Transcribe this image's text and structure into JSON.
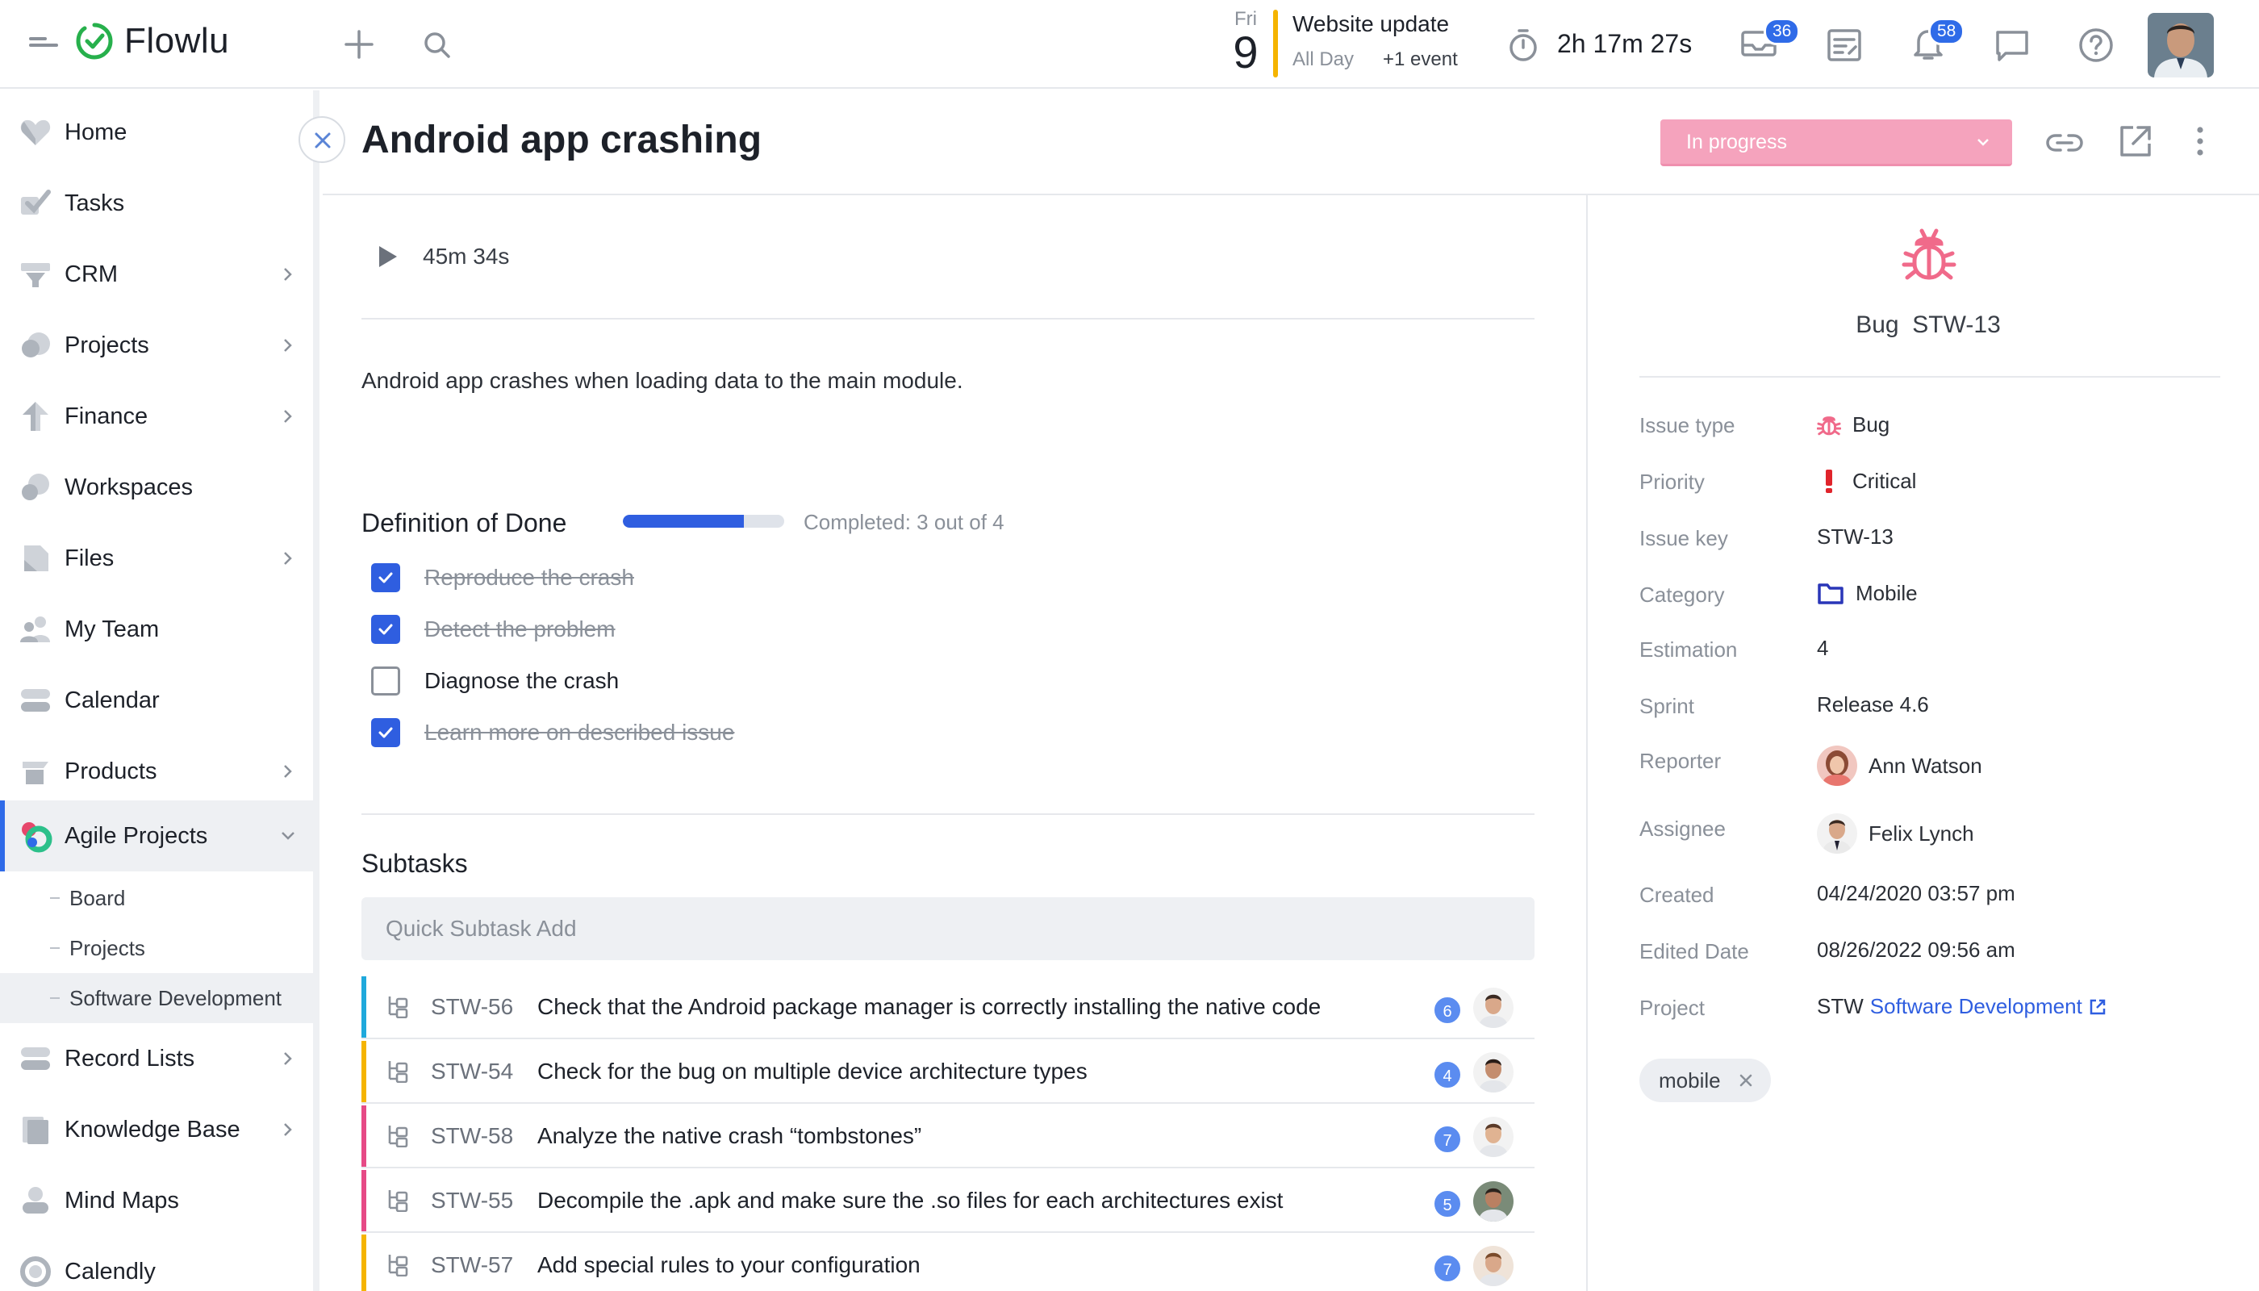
{
  "app": {
    "name": "Flowlu"
  },
  "topbar": {
    "calendar": {
      "weekday": "Fri",
      "day": "9",
      "event_title": "Website update",
      "event_time": "All Day",
      "event_more": "+1 event"
    },
    "timer": "2h 17m 27s",
    "mail_badge": "36",
    "notifications_badge": "58"
  },
  "sidebar": {
    "items": [
      {
        "label": "Home"
      },
      {
        "label": "Tasks"
      },
      {
        "label": "CRM"
      },
      {
        "label": "Projects"
      },
      {
        "label": "Finance"
      },
      {
        "label": "Workspaces"
      },
      {
        "label": "Files"
      },
      {
        "label": "My Team"
      },
      {
        "label": "Calendar"
      },
      {
        "label": "Products"
      },
      {
        "label": "Agile Projects"
      },
      {
        "label": "Record Lists"
      },
      {
        "label": "Knowledge Base"
      },
      {
        "label": "Mind Maps"
      },
      {
        "label": "Calendly"
      }
    ],
    "subitems": [
      {
        "label": "Board"
      },
      {
        "label": "Projects"
      },
      {
        "label": "Software Development"
      }
    ]
  },
  "issue": {
    "title": "Android app crashing",
    "status": "In progress",
    "time_tracked": "45m 34s",
    "description": "Android app crashes when loading data to the main module.",
    "type_label": "Bug",
    "key": "STW-13"
  },
  "dod": {
    "title": "Definition of Done",
    "progress": 0.75,
    "completed_text": "Completed: 3 out of 4",
    "items": [
      {
        "label": "Reproduce the crash",
        "done": true
      },
      {
        "label": "Detect the problem",
        "done": true
      },
      {
        "label": "Diagnose the crash",
        "done": false
      },
      {
        "label": "Learn more on described issue",
        "done": true
      }
    ]
  },
  "subtasks": {
    "title": "Subtasks",
    "quick_add_placeholder": "Quick Subtask Add",
    "items": [
      {
        "key": "STW-56",
        "title": "Check that the Android package manager is correctly installing the native code",
        "count": "6",
        "color": "#1fa9dc"
      },
      {
        "key": "STW-54",
        "title": "Check for the bug on multiple device architecture types",
        "count": "4",
        "color": "#f5b400"
      },
      {
        "key": "STW-58",
        "title": "Analyze the native crash “tombstones”",
        "count": "7",
        "color": "#e64a86"
      },
      {
        "key": "STW-55",
        "title": "Decompile the .apk and make sure the .so files for each architectures exist",
        "count": "5",
        "color": "#e64a86"
      },
      {
        "key": "STW-57",
        "title": "Add special rules to your configuration",
        "count": "7",
        "color": "#f5b400"
      }
    ]
  },
  "properties": {
    "issue_type": {
      "label": "Issue type",
      "value": "Bug"
    },
    "priority": {
      "label": "Priority",
      "value": "Critical"
    },
    "issue_key": {
      "label": "Issue key",
      "value": "STW-13"
    },
    "category": {
      "label": "Category",
      "value": "Mobile"
    },
    "estimation": {
      "label": "Estimation",
      "value": "4"
    },
    "sprint": {
      "label": "Sprint",
      "value": "Release 4.6"
    },
    "reporter": {
      "label": "Reporter",
      "value": "Ann Watson"
    },
    "assignee": {
      "label": "Assignee",
      "value": "Felix Lynch"
    },
    "created": {
      "label": "Created",
      "value": "04/24/2020 03:57 pm"
    },
    "edited": {
      "label": "Edited Date",
      "value": "08/26/2022 09:56 am"
    },
    "project": {
      "label": "Project",
      "prefix": "STW",
      "value": "Software Development"
    }
  },
  "tags": [
    "mobile"
  ],
  "colors": {
    "accent": "#2f5ee0",
    "status": "#f5a3bd",
    "bug": "#f06a8a",
    "priority": "#e0242b",
    "category": "#2a36b8",
    "calendar_event": "#f5b400"
  }
}
